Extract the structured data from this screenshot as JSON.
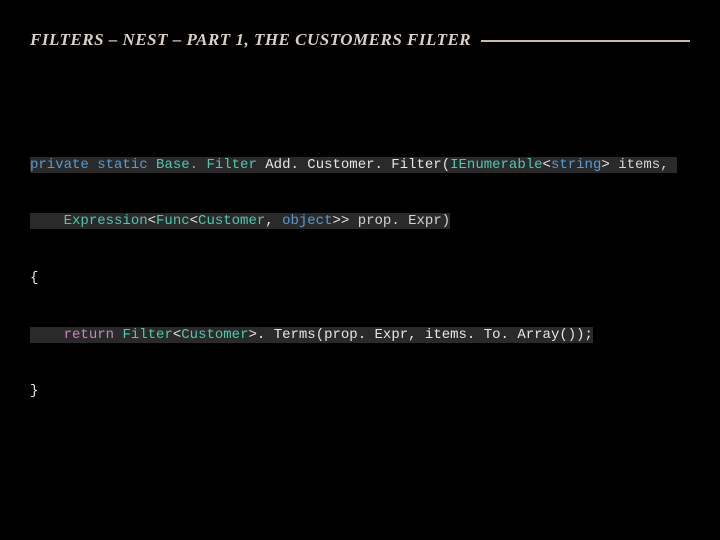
{
  "heading": "FILTERS – NEST – PART 1, THE CUSTOMERS FILTER",
  "code": {
    "l1": {
      "kw_private": "private",
      "sp1": " ",
      "kw_static": "static",
      "sp2": " ",
      "type1": "Base. Filter",
      "sp3": " ",
      "method": "Add. Customer. Filter",
      "lparen": "(",
      "type2": "IEnumerable",
      "lt1": "<",
      "kw_string": "string",
      "gt1": ">",
      "sp4": " ",
      "param1": "items,",
      "sp5": " "
    },
    "l2": {
      "indent": "    ",
      "type1": "Expression",
      "lt1": "<",
      "type2": "Func",
      "lt2": "<",
      "type3": "Customer",
      "comma": ", ",
      "kw_object": "object",
      "gt2": ">>",
      "sp1": " ",
      "param": "prop. Expr)"
    },
    "l3": {
      "brace": "{"
    },
    "l4": {
      "indent": "    ",
      "kw_return": "return",
      "sp1": " ",
      "type1": "Filter",
      "lt1": "<",
      "type2": "Customer",
      "gt1": ">",
      "rest": ". Terms(prop. Expr, items. To. Array());"
    },
    "l5": {
      "brace": "}"
    }
  }
}
